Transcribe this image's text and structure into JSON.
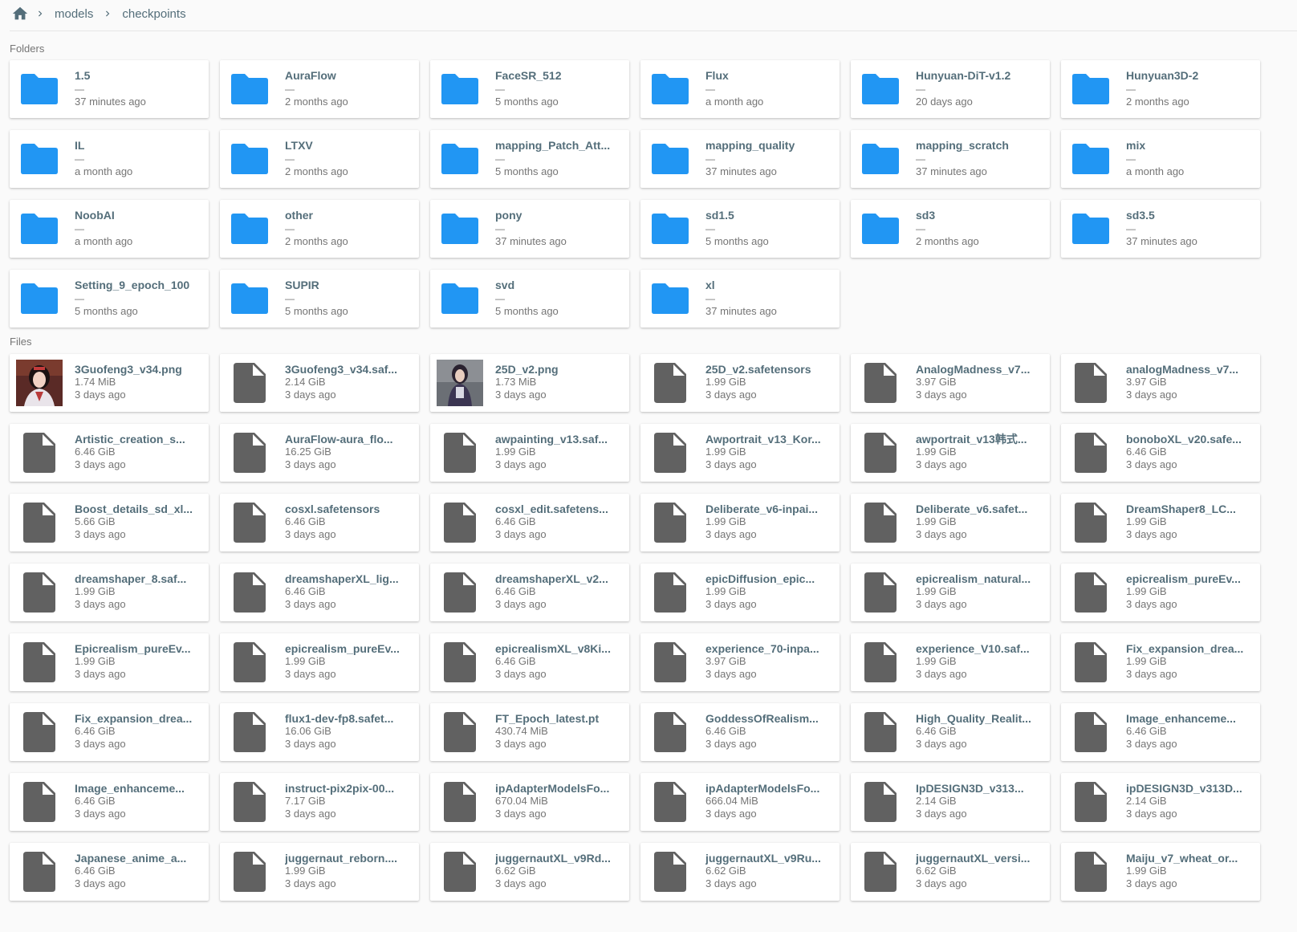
{
  "breadcrumb": {
    "items": [
      "models",
      "checkpoints"
    ]
  },
  "sections": {
    "folders_label": "Folders",
    "files_label": "Files"
  },
  "colors": {
    "folder_icon": "#2196f3",
    "file_icon": "#616161",
    "text": "#546e7a"
  },
  "icons": {
    "home": "home-icon",
    "separator": "chevron-right-icon",
    "folder": "folder-icon",
    "file": "file-icon"
  },
  "folders": [
    {
      "name": "1.5",
      "size": "—",
      "modified": "37 minutes ago"
    },
    {
      "name": "AuraFlow",
      "size": "—",
      "modified": "2 months ago"
    },
    {
      "name": "FaceSR_512",
      "size": "—",
      "modified": "5 months ago"
    },
    {
      "name": "Flux",
      "size": "—",
      "modified": "a month ago"
    },
    {
      "name": "Hunyuan-DiT-v1.2",
      "size": "—",
      "modified": "20 days ago"
    },
    {
      "name": "Hunyuan3D-2",
      "size": "—",
      "modified": "2 months ago"
    },
    {
      "name": "IL",
      "size": "—",
      "modified": "a month ago"
    },
    {
      "name": "LTXV",
      "size": "—",
      "modified": "2 months ago"
    },
    {
      "name": "mapping_Patch_Att...",
      "size": "—",
      "modified": "5 months ago"
    },
    {
      "name": "mapping_quality",
      "size": "—",
      "modified": "37 minutes ago"
    },
    {
      "name": "mapping_scratch",
      "size": "—",
      "modified": "37 minutes ago"
    },
    {
      "name": "mix",
      "size": "—",
      "modified": "a month ago"
    },
    {
      "name": "NoobAI",
      "size": "—",
      "modified": "a month ago"
    },
    {
      "name": "other",
      "size": "—",
      "modified": "2 months ago"
    },
    {
      "name": "pony",
      "size": "—",
      "modified": "37 minutes ago"
    },
    {
      "name": "sd1.5",
      "size": "—",
      "modified": "5 months ago"
    },
    {
      "name": "sd3",
      "size": "—",
      "modified": "2 months ago"
    },
    {
      "name": "sd3.5",
      "size": "—",
      "modified": "37 minutes ago"
    },
    {
      "name": "Setting_9_epoch_100",
      "size": "—",
      "modified": "5 months ago"
    },
    {
      "name": "SUPIR",
      "size": "—",
      "modified": "5 months ago"
    },
    {
      "name": "svd",
      "size": "—",
      "modified": "5 months ago"
    },
    {
      "name": "xl",
      "size": "—",
      "modified": "37 minutes ago"
    }
  ],
  "files": [
    {
      "name": "3Guofeng3_v34.png",
      "size": "1.74 MiB",
      "modified": "3 days ago",
      "thumb": "a"
    },
    {
      "name": "3Guofeng3_v34.saf...",
      "size": "2.14 GiB",
      "modified": "3 days ago"
    },
    {
      "name": "25D_v2.png",
      "size": "1.73 MiB",
      "modified": "3 days ago",
      "thumb": "b"
    },
    {
      "name": "25D_v2.safetensors",
      "size": "1.99 GiB",
      "modified": "3 days ago"
    },
    {
      "name": "AnalogMadness_v7...",
      "size": "3.97 GiB",
      "modified": "3 days ago"
    },
    {
      "name": "analogMadness_v7...",
      "size": "3.97 GiB",
      "modified": "3 days ago"
    },
    {
      "name": "Artistic_creation_s...",
      "size": "6.46 GiB",
      "modified": "3 days ago"
    },
    {
      "name": "AuraFlow-aura_flo...",
      "size": "16.25 GiB",
      "modified": "3 days ago"
    },
    {
      "name": "awpainting_v13.saf...",
      "size": "1.99 GiB",
      "modified": "3 days ago"
    },
    {
      "name": "Awportrait_v13_Kor...",
      "size": "1.99 GiB",
      "modified": "3 days ago"
    },
    {
      "name": "awportrait_v13韩式...",
      "size": "1.99 GiB",
      "modified": "3 days ago"
    },
    {
      "name": "bonoboXL_v20.safe...",
      "size": "6.46 GiB",
      "modified": "3 days ago"
    },
    {
      "name": "Boost_details_sd_xl...",
      "size": "5.66 GiB",
      "modified": "3 days ago"
    },
    {
      "name": "cosxl.safetensors",
      "size": "6.46 GiB",
      "modified": "3 days ago"
    },
    {
      "name": "cosxl_edit.safetens...",
      "size": "6.46 GiB",
      "modified": "3 days ago"
    },
    {
      "name": "Deliberate_v6-inpai...",
      "size": "1.99 GiB",
      "modified": "3 days ago"
    },
    {
      "name": "Deliberate_v6.safet...",
      "size": "1.99 GiB",
      "modified": "3 days ago"
    },
    {
      "name": "DreamShaper8_LC...",
      "size": "1.99 GiB",
      "modified": "3 days ago"
    },
    {
      "name": "dreamshaper_8.saf...",
      "size": "1.99 GiB",
      "modified": "3 days ago"
    },
    {
      "name": "dreamshaperXL_lig...",
      "size": "6.46 GiB",
      "modified": "3 days ago"
    },
    {
      "name": "dreamshaperXL_v2...",
      "size": "6.46 GiB",
      "modified": "3 days ago"
    },
    {
      "name": "epicDiffusion_epic...",
      "size": "1.99 GiB",
      "modified": "3 days ago"
    },
    {
      "name": "epicrealism_natural...",
      "size": "1.99 GiB",
      "modified": "3 days ago"
    },
    {
      "name": "epicrealism_pureEv...",
      "size": "1.99 GiB",
      "modified": "3 days ago"
    },
    {
      "name": "Epicrealism_pureEv...",
      "size": "1.99 GiB",
      "modified": "3 days ago"
    },
    {
      "name": "epicrealism_pureEv...",
      "size": "1.99 GiB",
      "modified": "3 days ago"
    },
    {
      "name": "epicrealismXL_v8Ki...",
      "size": "6.46 GiB",
      "modified": "3 days ago"
    },
    {
      "name": "experience_70-inpa...",
      "size": "3.97 GiB",
      "modified": "3 days ago"
    },
    {
      "name": "experience_V10.saf...",
      "size": "1.99 GiB",
      "modified": "3 days ago"
    },
    {
      "name": "Fix_expansion_drea...",
      "size": "1.99 GiB",
      "modified": "3 days ago"
    },
    {
      "name": "Fix_expansion_drea...",
      "size": "6.46 GiB",
      "modified": "3 days ago"
    },
    {
      "name": "flux1-dev-fp8.safet...",
      "size": "16.06 GiB",
      "modified": "3 days ago"
    },
    {
      "name": "FT_Epoch_latest.pt",
      "size": "430.74 MiB",
      "modified": "3 days ago"
    },
    {
      "name": "GoddessOfRealism...",
      "size": "6.46 GiB",
      "modified": "3 days ago"
    },
    {
      "name": "High_Quality_Realit...",
      "size": "6.46 GiB",
      "modified": "3 days ago"
    },
    {
      "name": "Image_enhanceme...",
      "size": "6.46 GiB",
      "modified": "3 days ago"
    },
    {
      "name": "Image_enhanceme...",
      "size": "6.46 GiB",
      "modified": "3 days ago"
    },
    {
      "name": "instruct-pix2pix-00...",
      "size": "7.17 GiB",
      "modified": "3 days ago"
    },
    {
      "name": "ipAdapterModelsFo...",
      "size": "670.04 MiB",
      "modified": "3 days ago"
    },
    {
      "name": "ipAdapterModelsFo...",
      "size": "666.04 MiB",
      "modified": "3 days ago"
    },
    {
      "name": "IpDESIGN3D_v313...",
      "size": "2.14 GiB",
      "modified": "3 days ago"
    },
    {
      "name": "ipDESIGN3D_v313D...",
      "size": "2.14 GiB",
      "modified": "3 days ago"
    },
    {
      "name": "Japanese_anime_a...",
      "size": "6.46 GiB",
      "modified": "3 days ago"
    },
    {
      "name": "juggernaut_reborn....",
      "size": "1.99 GiB",
      "modified": "3 days ago"
    },
    {
      "name": "juggernautXL_v9Rd...",
      "size": "6.62 GiB",
      "modified": "3 days ago"
    },
    {
      "name": "juggernautXL_v9Ru...",
      "size": "6.62 GiB",
      "modified": "3 days ago"
    },
    {
      "name": "juggernautXL_versi...",
      "size": "6.62 GiB",
      "modified": "3 days ago"
    },
    {
      "name": "Maiju_v7_wheat_or...",
      "size": "1.99 GiB",
      "modified": "3 days ago"
    }
  ]
}
